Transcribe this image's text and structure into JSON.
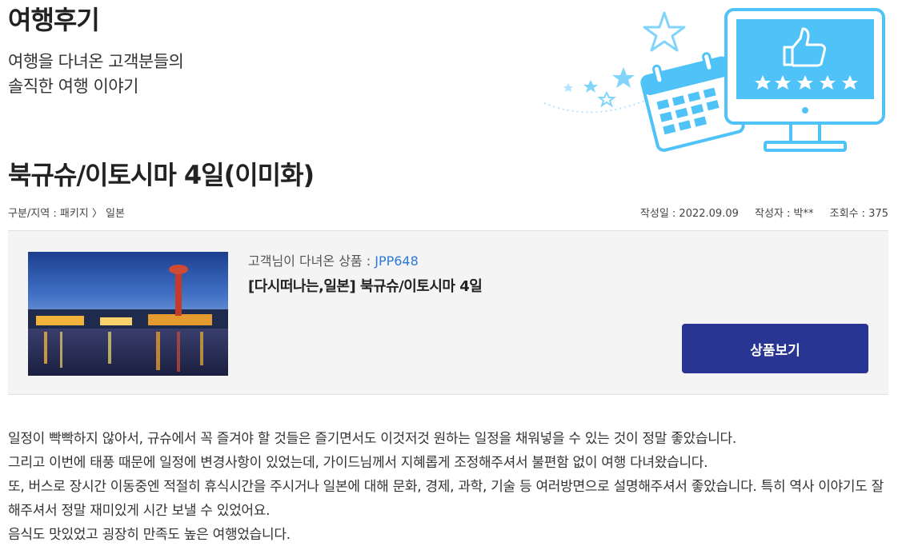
{
  "header": {
    "title": "여행후기",
    "subtitle_lines": [
      "여행을 다녀온 고객분들의",
      "솔직한 여행 이야기"
    ]
  },
  "review": {
    "title": "북규슈/이토시마 4일(이미화)",
    "category": "구분/지역 : 패키지 〉 일본",
    "date": "작성일 : 2022.09.09",
    "author": "작성자 : 박**",
    "views": "조회수 : 375",
    "product": {
      "label": "고객님이 다녀온 상품 : ",
      "code": "JPP648",
      "name": "[다시떠나는,일본] 북규슈/이토시마 4일",
      "button_label": "상품보기"
    },
    "body": [
      "일정이 빡빡하지 않아서, 규슈에서 꼭 즐겨야 할 것들은 즐기면서도 이것저것 원하는 일정을 채워넣을 수 있는 것이 정말 좋았습니다.",
      "그리고 이번에 태풍 때문에 일정에 변경사항이 있었는데, 가이드님께서 지혜롭게 조정해주셔서 불편함 없이 여행 다녀왔습니다.",
      " 또, 버스로 장시간 이동중엔 적절히 휴식시간을 주시거나 일본에 대해 문화, 경제, 과학, 기술 등 여러방면으로 설명해주셔서 좋았습니다. 특히 역사 이야기도 잘 해주셔서 정말 재미있게 시간 보낼 수 있었어요.",
      "음식도 맛있었고 굉장히 만족도 높은 여행었습니다."
    ]
  },
  "colors": {
    "button_bg": "#283593",
    "code_link": "#2a7ad6",
    "illustration_blue": "#4fc3f7"
  },
  "icons": [
    "star-icon",
    "calendar-icon",
    "monitor-icon",
    "thumbs-up-icon"
  ]
}
